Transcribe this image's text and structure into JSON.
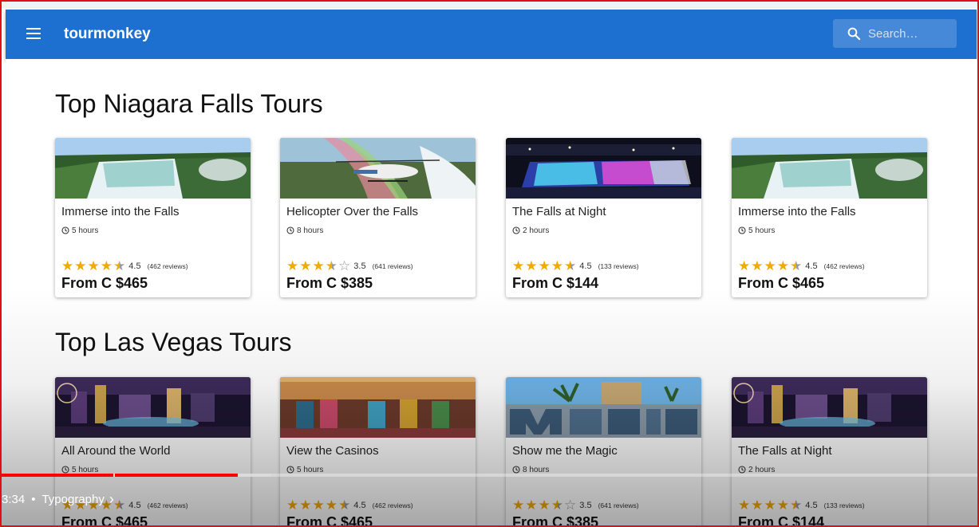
{
  "app": {
    "brand": "tourmonkey",
    "search_placeholder": "Search…"
  },
  "sections": [
    {
      "title": "Top Niagara Falls Tours",
      "cards": [
        {
          "title": "Immerse into the Falls",
          "duration": "5 hours",
          "rating": "4.5",
          "stars": 4.5,
          "reviews": "(462 reviews)",
          "price": "From C $465",
          "image": "waterfall-photo"
        },
        {
          "title": "Helicopter Over the Falls",
          "duration": "8 hours",
          "rating": "3.5",
          "stars": 3.5,
          "reviews": "(641 reviews)",
          "price": "From C $385",
          "image": "helicopter-photo"
        },
        {
          "title": "The Falls at Night",
          "duration": "2 hours",
          "rating": "4.5",
          "stars": 4.5,
          "reviews": "(133 reviews)",
          "price": "From C $144",
          "image": "night-falls-photo"
        },
        {
          "title": "Immerse into the Falls",
          "duration": "5 hours",
          "rating": "4.5",
          "stars": 4.5,
          "reviews": "(462 reviews)",
          "price": "From C $465",
          "image": "waterfall-photo"
        }
      ]
    },
    {
      "title": "Top Las Vegas Tours",
      "cards": [
        {
          "title": "All Around the World",
          "duration": "5 hours",
          "rating": "4.5",
          "stars": 4.5,
          "reviews": "(462 reviews)",
          "price": "From C $465",
          "image": "vegas-strip-photo"
        },
        {
          "title": "View the Casinos",
          "duration": "5 hours",
          "rating": "4.5",
          "stars": 4.5,
          "reviews": "(462 reviews)",
          "price": "From C $465",
          "image": "casino-photo"
        },
        {
          "title": "Show me the Magic",
          "duration": "8 hours",
          "rating": "3.5",
          "stars": 3.5,
          "reviews": "(641 reviews)",
          "price": "From C $385",
          "image": "magic-sign-photo"
        },
        {
          "title": "The Falls at Night",
          "duration": "2 hours",
          "rating": "4.5",
          "stars": 4.5,
          "reviews": "(133 reviews)",
          "price": "From C $144",
          "image": "vegas-strip-photo"
        }
      ]
    }
  ],
  "video": {
    "timestamp": "3:34",
    "separator": "•",
    "chapter": "Typography",
    "chevron": "›",
    "progress": 0.24
  },
  "colors": {
    "appbar": "#1d6fd0",
    "star": "#f2a900",
    "progress": "#ff0000"
  }
}
